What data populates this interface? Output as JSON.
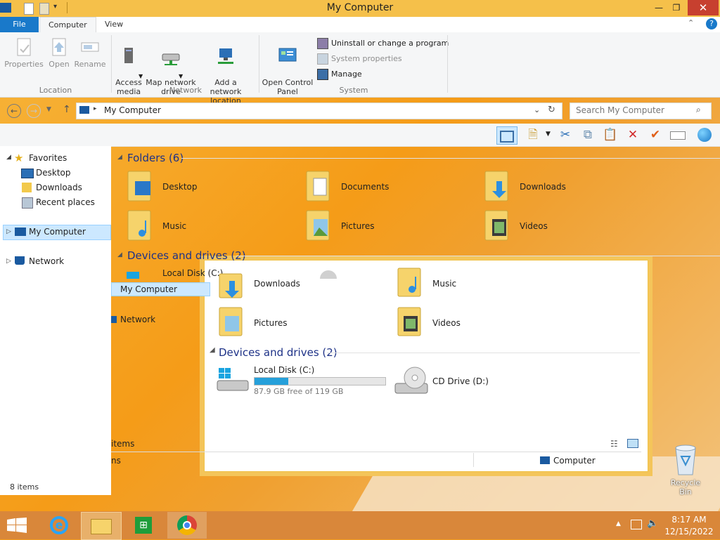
{
  "window": {
    "title": "My Computer"
  },
  "ribbon": {
    "tabs": [
      "File",
      "Computer",
      "View"
    ],
    "location": {
      "properties": "Properties",
      "open": "Open",
      "rename": "Rename",
      "label": "Location"
    },
    "network": {
      "access_media": "Access\nmedia",
      "map_drive": "Map network\ndrive",
      "add_location": "Add a network\nlocation",
      "label": "Network"
    },
    "system": {
      "open_control_panel": "Open Control\nPanel",
      "uninstall": "Uninstall or change a program",
      "system_properties": "System properties",
      "manage": "Manage",
      "label": "System"
    }
  },
  "address": {
    "path": "My Computer",
    "search_placeholder": "Search My Computer"
  },
  "nav": {
    "favorites": "Favorites",
    "desktop": "Desktop",
    "downloads": "Downloads",
    "recent": "Recent places",
    "my_computer": "My Computer",
    "network": "Network",
    "item_count": "8 items"
  },
  "content": {
    "folders_header": "Folders (6)",
    "folders": [
      "Desktop",
      "Documents",
      "Downloads",
      "Music",
      "Pictures",
      "Videos"
    ],
    "devices_header": "Devices and drives (2)"
  },
  "backwin": {
    "local_disk": "Local Disk (C:)",
    "my_computer": "My Computer",
    "network": "Network",
    "downloads": "Downloads",
    "music": "Music",
    "pictures": "Pictures",
    "videos": "Videos",
    "devices_header": "Devices and drives (2)",
    "drive_c": "Local Disk (C:)",
    "drive_c_free": "87.9 GB free of 119 GB",
    "drive_c_used_fraction": 0.26,
    "drive_d": "CD Drive (D:)",
    "status_items": "items",
    "status_items2": "ns",
    "status_computer": "Computer"
  },
  "desktop": {
    "recycle_bin": "Recycle Bin"
  },
  "taskbar": {
    "time": "8:17 AM",
    "date": "12/15/2022"
  },
  "colors": {
    "accent": "#1979ca",
    "title_bar": "#f5c04a",
    "taskbar": "#d9873a",
    "selection": "#cce8ff",
    "drive_fill": "#26a0da"
  }
}
